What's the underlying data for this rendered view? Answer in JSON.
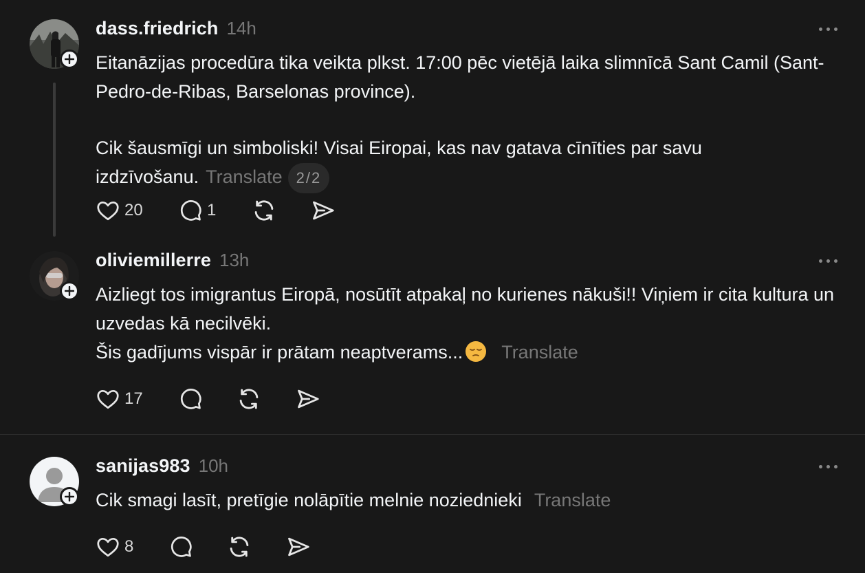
{
  "posts": [
    {
      "username": "dass.friedrich",
      "time": "14h",
      "line1": "Eitanāzijas procedūra tika veikta plkst. 17:00 pēc vietējā laika slimnīcā Sant Camil (Sant-Pedro-de-Ribas, Barselonas province).",
      "line2": "Cik šausmīgi un simboliski! Visai Eiropai, kas nav gatava cīnīties par savu izdzīvošanu.",
      "translate": "Translate",
      "page_indicator": "2/2",
      "likes": "20",
      "replies": "1"
    },
    {
      "username": "oliviemillerre",
      "time": "13h",
      "line1": "Aizliegt tos imigrantus Eiropā, nosūtīt atpakaļ no kurienes nākuši!! Viņiem ir cita kultura un uzvedas kā necilvēki.",
      "line2": "Šis gadījums vispār ir prātam neaptverams...",
      "translate": "Translate",
      "likes": "17"
    },
    {
      "username": "sanijas983",
      "time": "10h",
      "line1": "Cik smagi lasīt, pretīgie nolāpītie melnie noziednieki",
      "translate": "Translate",
      "likes": "8"
    }
  ],
  "icons": [
    "heart-icon",
    "comment-icon",
    "repost-icon",
    "share-icon",
    "more-icon",
    "follow-plus-icon",
    "pensive-emoji"
  ],
  "colors": {
    "background": "#181818",
    "text": "#f3f5f7",
    "muted": "#777777",
    "divider": "#2f2f2f"
  }
}
